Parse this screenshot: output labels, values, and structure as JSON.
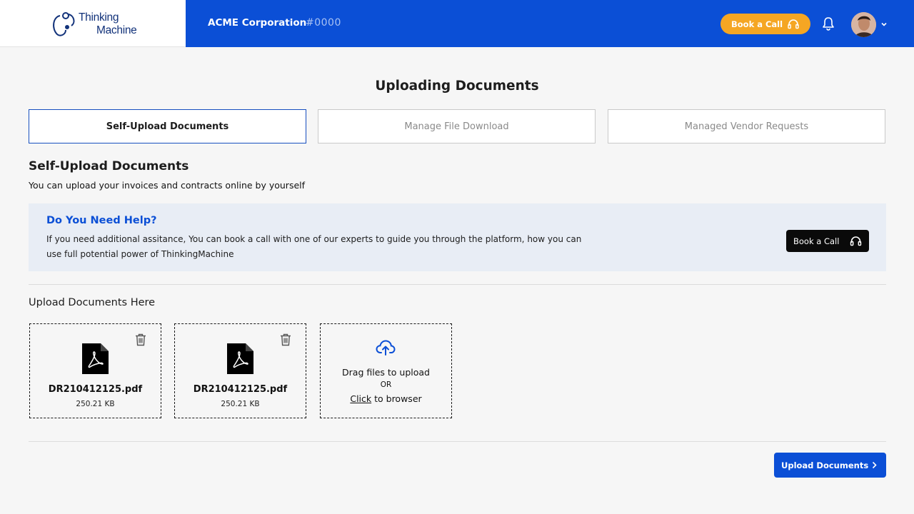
{
  "header": {
    "logo": {
      "line1": "Thinking",
      "line2": "Machine",
      "icon": "thinking-machine-logo"
    },
    "company_name": "ACME Corporation",
    "company_id": "#0000",
    "book_call_label": "Book a Call",
    "book_call_icon": "headset-icon",
    "notification_icon": "bell-icon",
    "user_menu_icon": "chevron-down-icon",
    "colors": {
      "bar": "#0b4fd6",
      "accent": "#f5a623"
    }
  },
  "page": {
    "title": "Uploading Documents",
    "tabs": [
      {
        "label": "Self-Upload Documents",
        "active": true
      },
      {
        "label": "Manage File Download",
        "active": false
      },
      {
        "label": "Managed Vendor Requests",
        "active": false
      }
    ],
    "section_title": "Self-Upload Documents",
    "section_subtitle": "You can upload your invoices and contracts online by yourself"
  },
  "help": {
    "title": "Do You Need Help?",
    "text": "If you need additional assitance, You can book a call with one of our experts to guide you through the platform, how you can use full potential power of ThinkingMachine",
    "button_label": "Book a Call"
  },
  "upload": {
    "title": "Upload Documents Here",
    "files": [
      {
        "name": "DR210412125.pdf",
        "size": "250.21 KB",
        "icon": "pdf-file-icon"
      },
      {
        "name": "DR210412125.pdf",
        "size": "250.21 KB",
        "icon": "pdf-file-icon"
      }
    ],
    "dropzone": {
      "line1": "Drag files to upload",
      "line2": "OR",
      "click_label": "Click",
      "line3_suffix": " to browser",
      "icon": "cloud-upload-icon"
    },
    "submit_label": "Upload Documents"
  }
}
